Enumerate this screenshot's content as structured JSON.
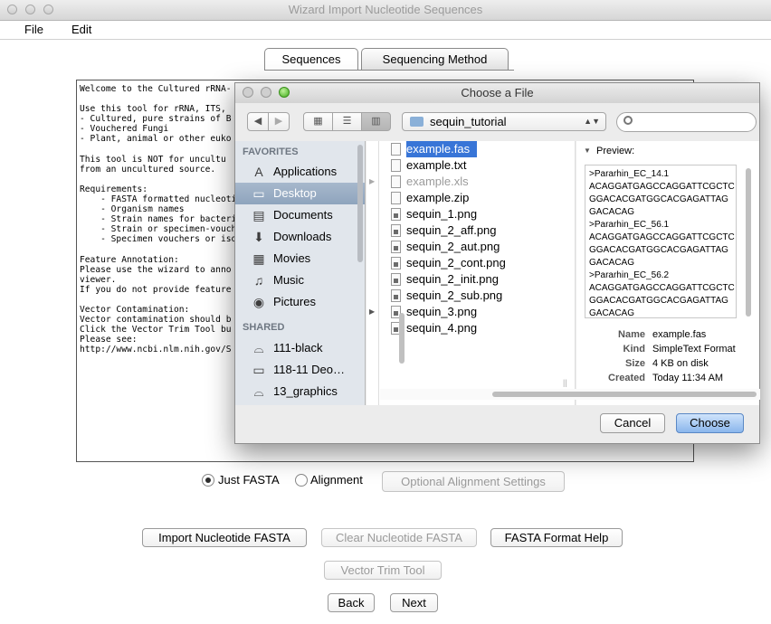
{
  "window": {
    "title": "Wizard Import Nucleotide Sequences"
  },
  "menu": [
    "File",
    "Edit"
  ],
  "tabs": [
    {
      "label": "Sequences",
      "active": true
    },
    {
      "label": "Sequencing Method",
      "active": false
    }
  ],
  "info_lines": [
    "Welcome to the Cultured rRNA-",
    "",
    "Use this tool for rRNA, ITS,",
    "- Cultured, pure strains of B",
    "- Vouchered Fungi",
    "- Plant, animal or other euko",
    "",
    "This tool is NOT for uncultu",
    "from an uncultured source.",
    "",
    "Requirements:",
    "    - FASTA formatted nucleoti",
    "    - Organism names",
    "    - Strain names for bacteri",
    "    - Strain or specimen-vouch",
    "    - Specimen vouchers or iso",
    "",
    "Feature Annotation:",
    "Please use the wizard to anno",
    "viewer.",
    "If you do not provide feature",
    "",
    "Vector Contamination:",
    "Vector contamination should b",
    "Click the Vector Trim Tool bu",
    "Please see:",
    "http://www.ncbi.nlm.nih.gov/S"
  ],
  "format_options": {
    "just_fasta": "Just FASTA",
    "alignment": "Alignment",
    "settings": "Optional Alignment Settings"
  },
  "buttons": {
    "import": "Import Nucleotide FASTA",
    "clear": "Clear Nucleotide FASTA",
    "help": "FASTA Format Help",
    "vector": "Vector Trim Tool",
    "back": "Back",
    "next": "Next"
  },
  "dialog": {
    "title": "Choose a File",
    "location": "sequin_tutorial",
    "favorites_header": "FAVORITES",
    "shared_header": "SHARED",
    "favorites": [
      {
        "label": "Applications",
        "icon": "A"
      },
      {
        "label": "Desktop",
        "icon": "▭",
        "selected": true
      },
      {
        "label": "Documents",
        "icon": "▤"
      },
      {
        "label": "Downloads",
        "icon": "⬇"
      },
      {
        "label": "Movies",
        "icon": "▦"
      },
      {
        "label": "Music",
        "icon": "♫"
      },
      {
        "label": "Pictures",
        "icon": "◉"
      }
    ],
    "shared": [
      {
        "label": "111-black",
        "icon": "⌓"
      },
      {
        "label": "118-11 Deo…",
        "icon": "▭"
      },
      {
        "label": "13_graphics",
        "icon": "⌓"
      }
    ],
    "files": [
      {
        "name": "example.fas",
        "kind": "doc",
        "selected": true
      },
      {
        "name": "example.txt",
        "kind": "doc"
      },
      {
        "name": "example.xls",
        "kind": "doc",
        "disabled": true
      },
      {
        "name": "example.zip",
        "kind": "doc"
      },
      {
        "name": "sequin_1.png",
        "kind": "img"
      },
      {
        "name": "sequin_2_aff.png",
        "kind": "img"
      },
      {
        "name": "sequin_2_aut.png",
        "kind": "img"
      },
      {
        "name": "sequin_2_cont.png",
        "kind": "img"
      },
      {
        "name": "sequin_2_init.png",
        "kind": "img"
      },
      {
        "name": "sequin_2_sub.png",
        "kind": "img"
      },
      {
        "name": "sequin_3.png",
        "kind": "img"
      },
      {
        "name": "sequin_4.png",
        "kind": "img"
      }
    ],
    "preview_label": "Preview:",
    "preview_lines": [
      ">Pararhin_EC_14.1",
      "ACAGGATGAGCCAGGATTCGCTC",
      "GGACACGATGGCACGAGATTAG",
      "GACACAG",
      ">Pararhin_EC_56.1",
      "ACAGGATGAGCCAGGATTCGCTC",
      "GGACACGATGGCACGAGATTAG",
      "GACACAG",
      ">Pararhin_EC_56.2",
      "ACAGGATGAGCCAGGATTCGCTC",
      "GGACACGATGGCACGAGATTAG",
      "GACACAG"
    ],
    "meta": [
      {
        "label": "Name",
        "value": "example.fas"
      },
      {
        "label": "Kind",
        "value": "SimpleText Format"
      },
      {
        "label": "Size",
        "value": "4 KB on disk"
      },
      {
        "label": "Created",
        "value": "Today 11:34 AM"
      }
    ],
    "cancel": "Cancel",
    "choose": "Choose"
  },
  "colors": {
    "selection": "#3875d7",
    "sidebar_bg": "#e1e6ec",
    "default_button": "#8ab6ec"
  }
}
